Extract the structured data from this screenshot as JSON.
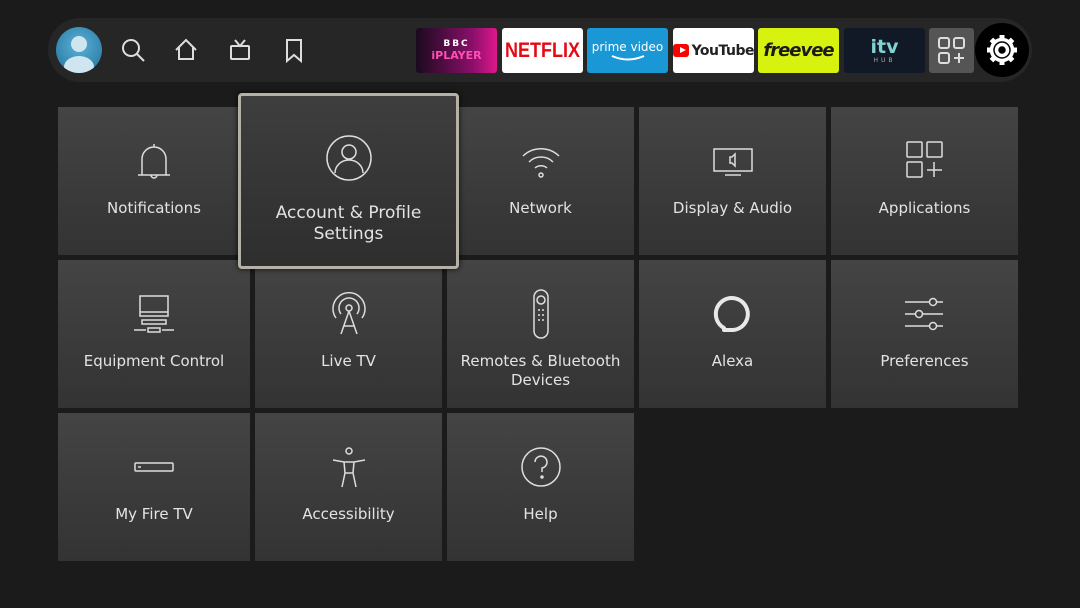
{
  "topbar": {
    "nav": [
      {
        "icon": "profile-avatar"
      },
      {
        "icon": "search-icon"
      },
      {
        "icon": "home-icon"
      },
      {
        "icon": "live-tv-icon"
      },
      {
        "icon": "bookmark-icon"
      }
    ],
    "apps": [
      {
        "name": "BBC iPlayer",
        "line1": "BBC",
        "line2": "iPLAYER"
      },
      {
        "name": "Netflix",
        "line1": "NETFLIX"
      },
      {
        "name": "Prime Video",
        "line1": "prime video"
      },
      {
        "name": "YouTube",
        "line1": "YouTube"
      },
      {
        "name": "Freevee",
        "line1": "freevee"
      },
      {
        "name": "ITV Hub",
        "line1": "itv",
        "line2": "HUB"
      }
    ],
    "all_apps_icon": "apps-grid-icon",
    "settings_icon": "gear-icon"
  },
  "colors": {
    "focus_border": "#b5b1a6",
    "netflix": "#e50914",
    "prime": "#1a98d5",
    "freevee": "#d7f20f",
    "bbc": "#e0178b",
    "youtube": "#ff0000"
  },
  "tiles": [
    {
      "label": "Notifications",
      "icon": "bell-icon"
    },
    {
      "label": "Account & Profile Settings",
      "icon": "user-circle-icon",
      "focused": true
    },
    {
      "label": "Network",
      "icon": "wifi-icon"
    },
    {
      "label": "Display & Audio",
      "icon": "display-audio-icon"
    },
    {
      "label": "Applications",
      "icon": "applications-icon"
    },
    {
      "label": "Equipment Control",
      "icon": "tv-equipment-icon"
    },
    {
      "label": "Live TV",
      "icon": "antenna-icon"
    },
    {
      "label": "Remotes & Bluetooth Devices",
      "icon": "remote-icon"
    },
    {
      "label": "Alexa",
      "icon": "alexa-icon"
    },
    {
      "label": "Preferences",
      "icon": "sliders-icon"
    },
    {
      "label": "My Fire TV",
      "icon": "fire-tv-stick-icon"
    },
    {
      "label": "Accessibility",
      "icon": "accessibility-icon"
    },
    {
      "label": "Help",
      "icon": "help-icon"
    }
  ]
}
